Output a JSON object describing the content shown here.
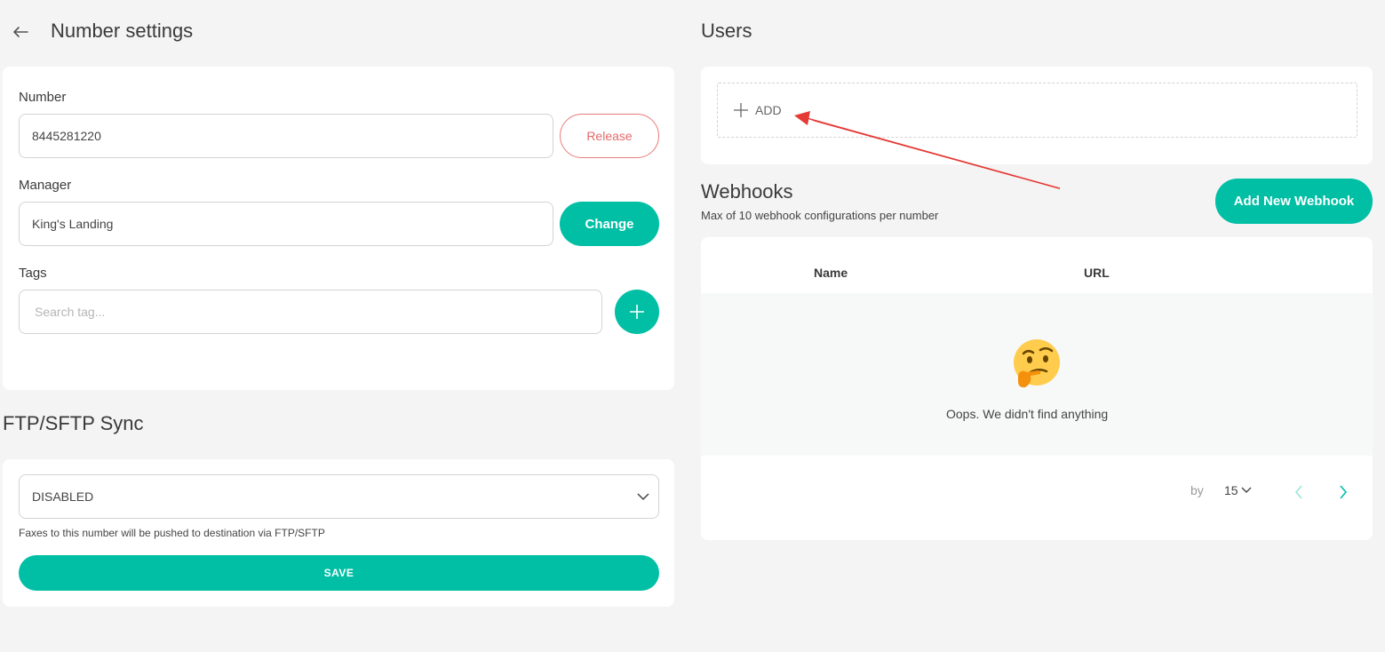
{
  "header": {
    "back_icon": "arrow-left-icon",
    "title": "Number settings"
  },
  "number_section": {
    "number_label": "Number",
    "number_value": "8445281220",
    "release_label": "Release",
    "manager_label": "Manager",
    "manager_value": "King's Landing",
    "change_label": "Change",
    "tags_label": "Tags",
    "tags_placeholder": "Search tag...",
    "add_tag_icon": "plus-icon"
  },
  "ftp": {
    "title": "FTP/SFTP Sync",
    "selected": "DISABLED",
    "hint": "Faxes to this number will be pushed to destination via FTP/SFTP",
    "save_label": "SAVE"
  },
  "users": {
    "title": "Users",
    "add_label": "ADD"
  },
  "webhooks": {
    "title": "Webhooks",
    "subtitle": "Max of 10 webhook configurations per number",
    "add_label": "Add New Webhook",
    "columns": [
      "Name",
      "URL"
    ],
    "empty_icon": "thinking-face-icon",
    "empty_text": "Oops. We didn't find anything",
    "pagination": {
      "by_label": "by",
      "page_size": "15"
    }
  },
  "annotation": {
    "arrow_color": "#e53935"
  },
  "colors": {
    "accent": "#00bfa5",
    "danger": "#e46a6a"
  }
}
